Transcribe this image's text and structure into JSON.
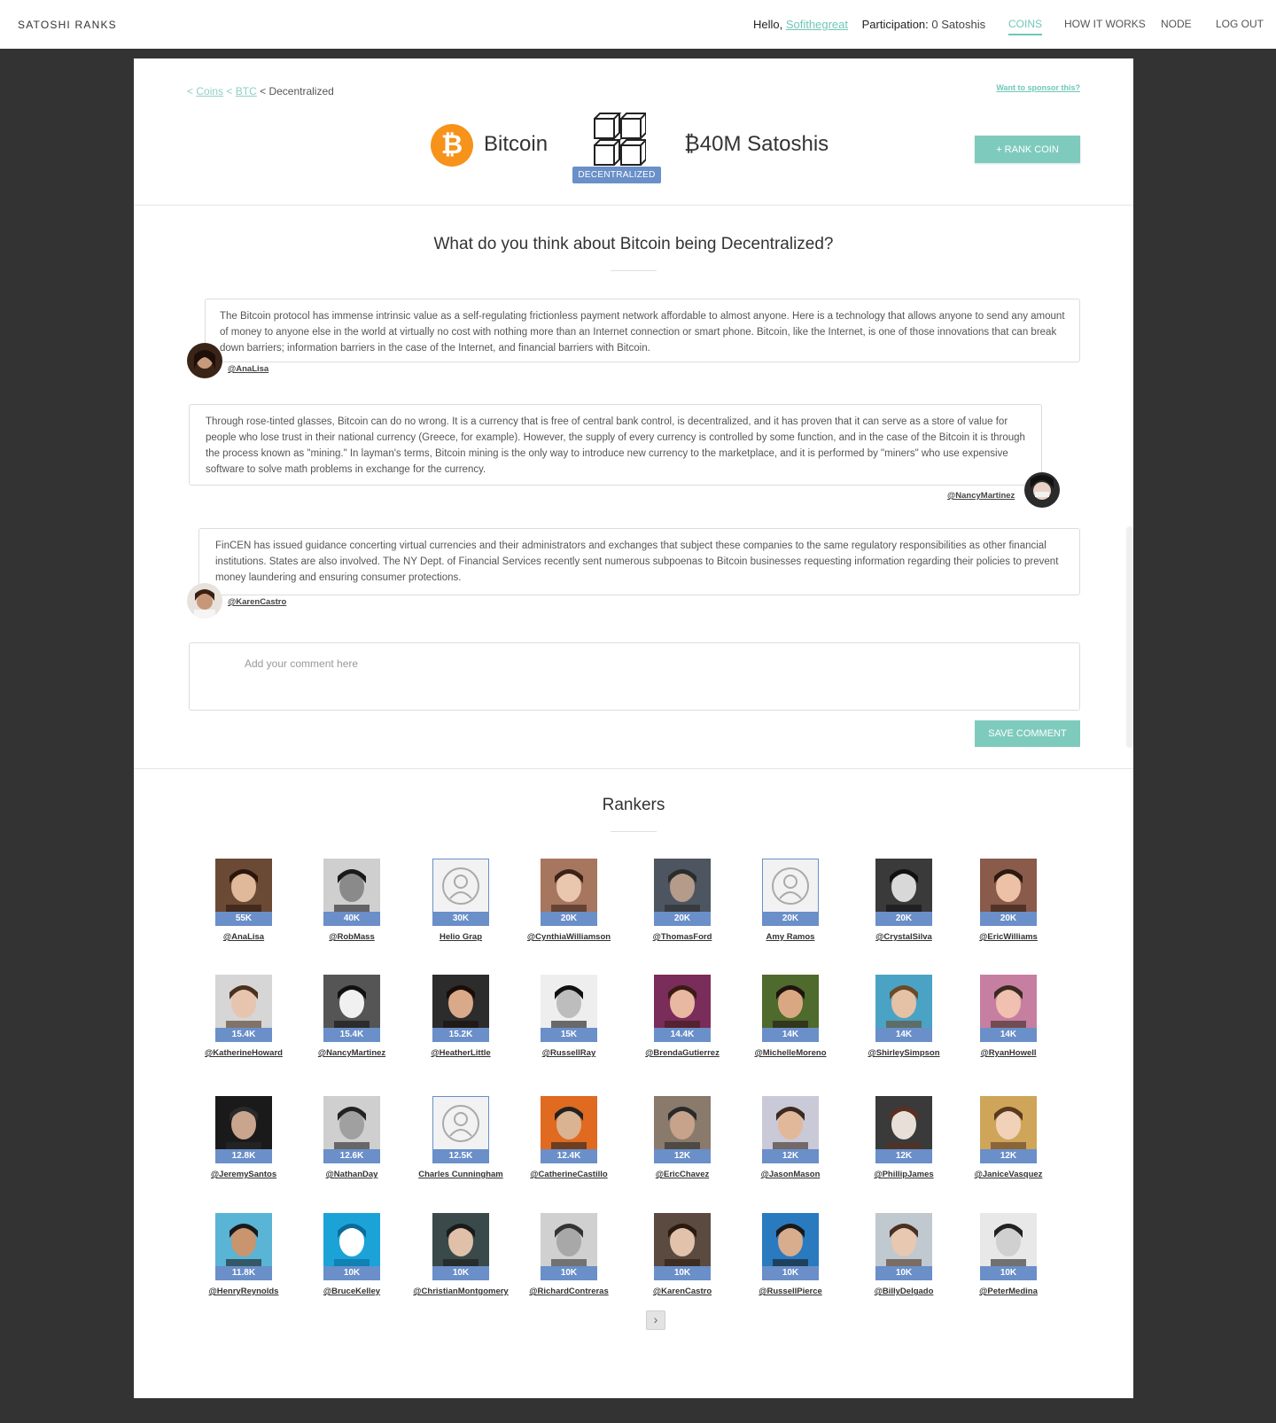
{
  "nav": {
    "brand": "SATOSHI RANKS",
    "hello_prefix": "Hello,",
    "username": "Sofithegreat",
    "participation_label": "Participation:",
    "participation_value": "0 Satoshis",
    "links": [
      "COINS",
      "HOW IT WORKS",
      "NODE",
      "LOG OUT"
    ],
    "active_link": "COINS",
    "accent_color": "#6fc7b8"
  },
  "breadcrumb": {
    "sep": "<",
    "coins": "Coins",
    "btc": "BTC",
    "current": "Decentralized"
  },
  "sponsor_link": "Want to sponsor this?",
  "coin": {
    "symbol": "₿",
    "name": "Bitcoin",
    "category": "DECENTRALIZED",
    "satoshis": "₿40M Satoshis",
    "rank_button": "+ RANK COIN",
    "brand_color": "#f7931a"
  },
  "question": "What do you think about Bitcoin being Decentralized?",
  "comments": [
    {
      "text": "The Bitcoin protocol has immense intrinsic value as a self-regulating frictionless payment network affordable to almost anyone. Here is a technology that allows anyone to send any amount of money to anyone else in the world at virtually no cost with nothing more than an Internet connection or smart phone. Bitcoin, like the Internet, is one of those innovations that can break down barriers; information barriers in the case of the Internet, and financial barriers with Bitcoin.",
      "author": "@AnaLisa"
    },
    {
      "text": "Through rose-tinted glasses, Bitcoin can do no wrong. It is a currency that is free of central bank control, is decentralized, and it has proven that it can serve as a store of value for people who lose trust in their national currency (Greece, for example). However, the supply of every currency is controlled by some function, and in the case of the Bitcoin it is through the process known as \"mining.\" In layman's terms, Bitcoin mining is the only way to introduce new currency to the marketplace, and it is performed by \"miners\" who use expensive software to solve math problems in exchange for the currency.",
      "author": "@NancyMartinez"
    },
    {
      "text": "FinCEN has issued guidance concerting virtual currencies and their administrators and exchanges that subject these companies to the same regulatory responsibilities as other financial institutions. States are also involved. The NY Dept. of Financial Services recently sent numerous subpoenas to Bitcoin businesses requesting information regarding their policies to prevent money laundering and ensuring consumer protections.",
      "author": "@KarenCastro"
    }
  ],
  "comment_form": {
    "placeholder": "Add your comment here",
    "save_label": "SAVE COMMENT"
  },
  "rankers_title": "Rankers",
  "rankers": [
    {
      "name": "@AnaLisa",
      "score": "55K"
    },
    {
      "name": "@RobMass",
      "score": "40K"
    },
    {
      "name": "Helio Grap",
      "score": "30K"
    },
    {
      "name": "@CynthiaWilliamson",
      "score": "20K"
    },
    {
      "name": "@ThomasFord",
      "score": "20K"
    },
    {
      "name": "Amy Ramos",
      "score": "20K"
    },
    {
      "name": "@CrystalSilva",
      "score": "20K"
    },
    {
      "name": "@EricWilliams",
      "score": "20K"
    },
    {
      "name": "@KatherineHoward",
      "score": "15.4K"
    },
    {
      "name": "@NancyMartinez",
      "score": "15.4K"
    },
    {
      "name": "@HeatherLittle",
      "score": "15.2K"
    },
    {
      "name": "@RussellRay",
      "score": "15K"
    },
    {
      "name": "@BrendaGutierrez",
      "score": "14.4K"
    },
    {
      "name": "@MichelleMoreno",
      "score": "14K"
    },
    {
      "name": "@ShirleySimpson",
      "score": "14K"
    },
    {
      "name": "@RyanHowell",
      "score": "14K"
    },
    {
      "name": "@JeremySantos",
      "score": "12.8K"
    },
    {
      "name": "@NathanDay",
      "score": "12.6K"
    },
    {
      "name": "Charles Cunningham",
      "score": "12.5K"
    },
    {
      "name": "@CatherineCastillo",
      "score": "12.4K"
    },
    {
      "name": "@EricChavez",
      "score": "12K"
    },
    {
      "name": "@JasonMason",
      "score": "12K"
    },
    {
      "name": "@PhillipJames",
      "score": "12K"
    },
    {
      "name": "@JaniceVasquez",
      "score": "12K"
    },
    {
      "name": "@HenryReynolds",
      "score": "11.8K"
    },
    {
      "name": "@BruceKelley",
      "score": "10K"
    },
    {
      "name": "@ChristianMontgomery",
      "score": "10K"
    },
    {
      "name": "@RichardContreras",
      "score": "10K"
    },
    {
      "name": "@KarenCastro",
      "score": "10K"
    },
    {
      "name": "@RussellPierce",
      "score": "10K"
    },
    {
      "name": "@BillyDelgado",
      "score": "10K"
    },
    {
      "name": "@PeterMedina",
      "score": "10K"
    }
  ],
  "pagination": {
    "next_icon": "chevron-right-icon",
    "next_glyph": "›"
  },
  "score_badge_color": "#6a8fc9"
}
